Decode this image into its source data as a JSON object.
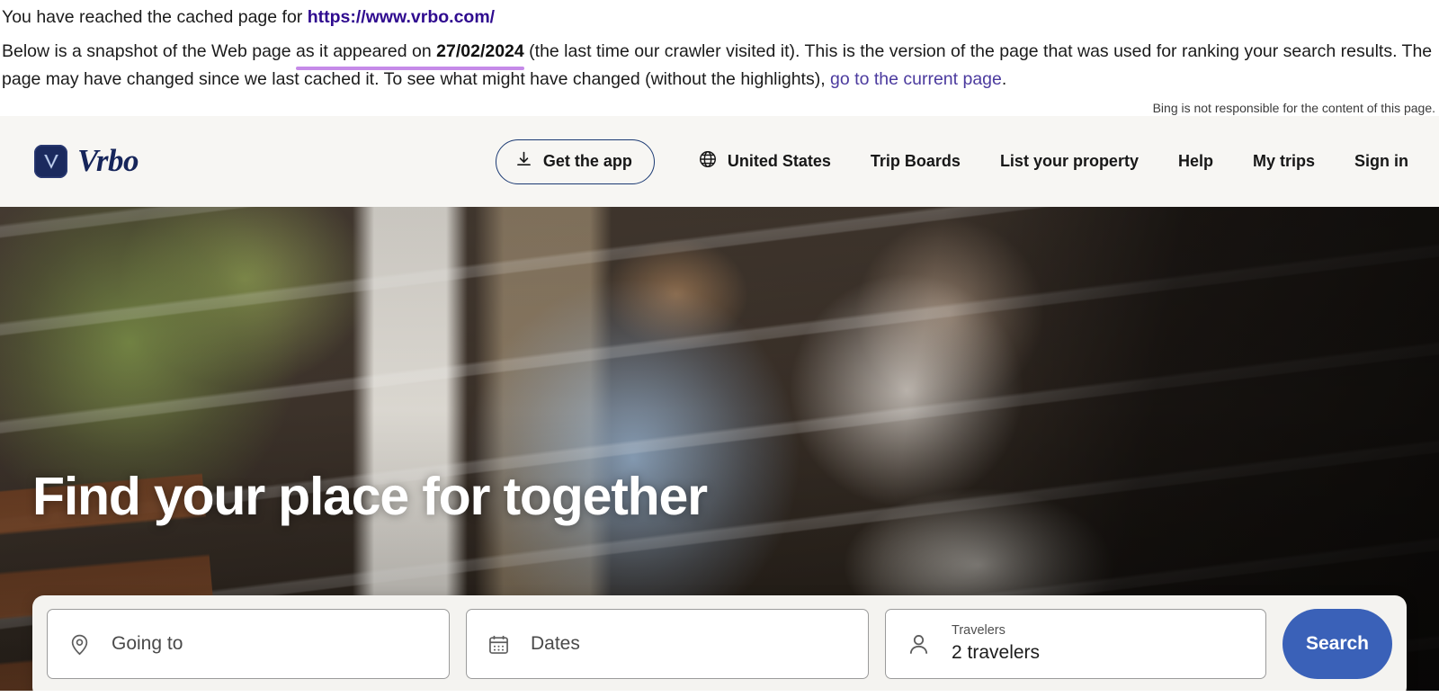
{
  "cache_banner": {
    "line1_prefix": "You have reached the cached page for ",
    "url": "https://www.vrbo.com/",
    "body_part1": "Below is a snapshot of the Web page ",
    "highlight_prefix": "as it appeared on ",
    "highlight_date": "27/02/2024",
    "body_part2": " (the last time our crawler visited it). This is the version of the page that was used for ranking your search results. The page may have changed since we last cached it. To see what might have changed (without the highlights), ",
    "current_page_link": "go to the current page",
    "body_part3": ".",
    "disclaimer": "Bing is not responsible for the content of this page.",
    "link_color": "#2f0b8f",
    "highlight_color": "#c58ae8"
  },
  "navbar": {
    "logo_letter": "V",
    "logo_wordmark": "Vrbo",
    "get_app_label": "Get the app",
    "items": [
      {
        "label": "United States",
        "icon": "globe-icon"
      },
      {
        "label": "Trip Boards",
        "icon": ""
      },
      {
        "label": "List your property",
        "icon": ""
      },
      {
        "label": "Help",
        "icon": ""
      },
      {
        "label": "My trips",
        "icon": ""
      },
      {
        "label": "Sign in",
        "icon": ""
      }
    ],
    "background": "#f7f6f3"
  },
  "hero": {
    "title": "Find your place for together"
  },
  "search": {
    "going_to_placeholder": "Going to",
    "dates_placeholder": "Dates",
    "travelers_label": "Travelers",
    "travelers_value": "2 travelers",
    "search_button": "Search",
    "search_button_color": "#3a61b8"
  }
}
